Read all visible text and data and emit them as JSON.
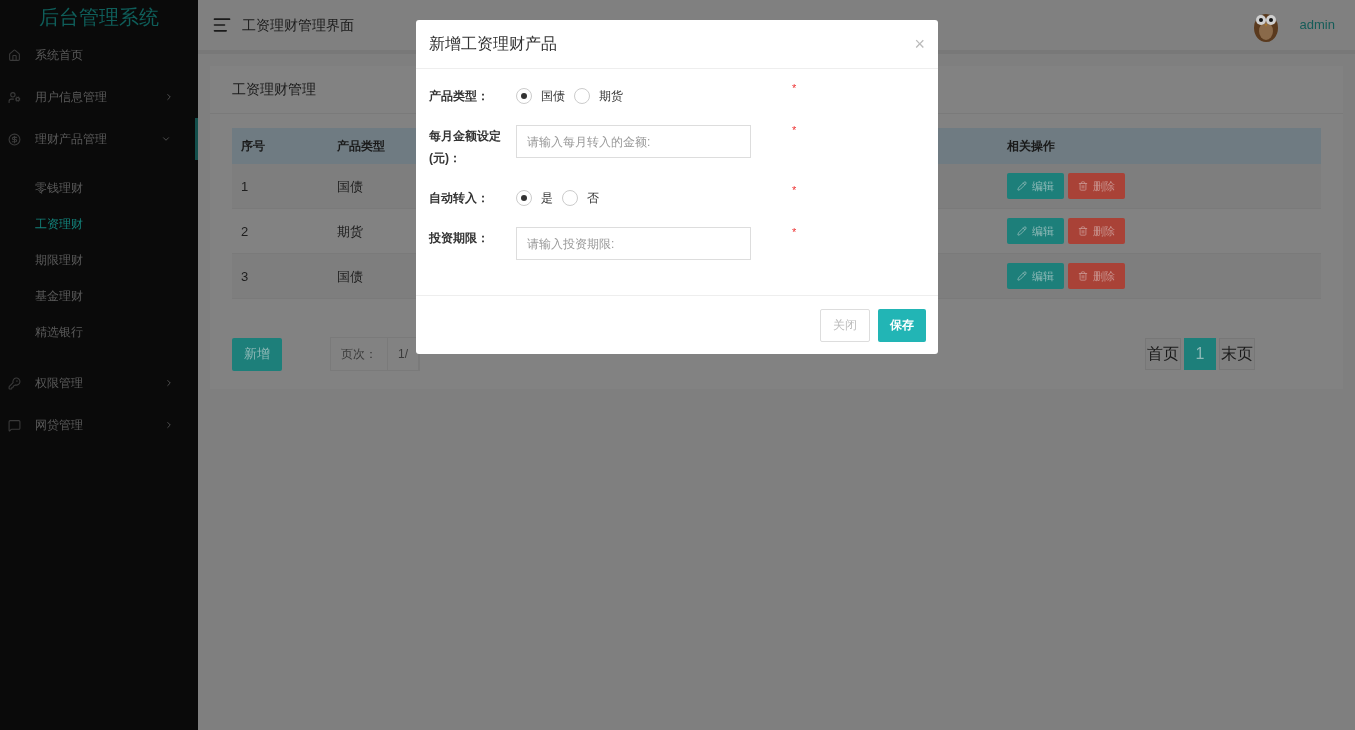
{
  "sidebar": {
    "title": "后台管理系统",
    "items": [
      {
        "label": "系统首页",
        "expandable": false,
        "expanded": false
      },
      {
        "label": "用户信息管理",
        "expandable": true,
        "expanded": false
      },
      {
        "label": "理财产品管理",
        "expandable": true,
        "expanded": true,
        "children": [
          {
            "label": "零钱理财",
            "selected": false
          },
          {
            "label": "工资理财",
            "selected": true
          },
          {
            "label": "期限理财",
            "selected": false
          },
          {
            "label": "基金理财",
            "selected": false
          },
          {
            "label": "精选银行",
            "selected": false
          }
        ]
      },
      {
        "label": "权限管理",
        "expandable": true,
        "expanded": false
      },
      {
        "label": "网贷管理",
        "expandable": true,
        "expanded": false
      }
    ]
  },
  "header": {
    "title": "工资理财管理界面",
    "user": "admin"
  },
  "panel": {
    "title": "工资理财管理",
    "table": {
      "columns": [
        "序号",
        "产品类型",
        "相关操作"
      ],
      "rows": [
        {
          "cells": [
            "1",
            "国债"
          ],
          "actions": [
            "编辑",
            "删除"
          ]
        },
        {
          "cells": [
            "2",
            "期货"
          ],
          "actions": [
            "编辑",
            "删除"
          ]
        },
        {
          "cells": [
            "3",
            "国债"
          ],
          "actions": [
            "编辑",
            "删除"
          ]
        }
      ]
    },
    "add_button": "新增",
    "pager_info": [
      "页次：",
      "1/"
    ],
    "pagination": [
      {
        "label": "首页",
        "selected": false
      },
      {
        "label": "1",
        "selected": true
      },
      {
        "label": "末页",
        "selected": false
      }
    ]
  },
  "dialog": {
    "title": "新增工资理财产品",
    "close": "×",
    "fields": [
      {
        "kind": "radio",
        "label": "产品类型：",
        "required_mark": "*",
        "options": [
          {
            "label": "国债",
            "selected": true
          },
          {
            "label": "期货",
            "selected": false
          }
        ]
      },
      {
        "kind": "input",
        "label": "每月金额设定(元)：",
        "required_mark": "*",
        "placeholder": "请输入每月转入的金额:"
      },
      {
        "kind": "radio",
        "label": "自动转入：",
        "required_mark": "*",
        "options": [
          {
            "label": "是",
            "selected": true
          },
          {
            "label": "否",
            "selected": false
          }
        ]
      },
      {
        "kind": "input",
        "label": "投资期限：",
        "required_mark": "*",
        "placeholder": "请输入投资期限:"
      }
    ],
    "buttons": [
      {
        "label": "关闭",
        "kind": "default"
      },
      {
        "label": "保存",
        "kind": "primary"
      }
    ]
  }
}
